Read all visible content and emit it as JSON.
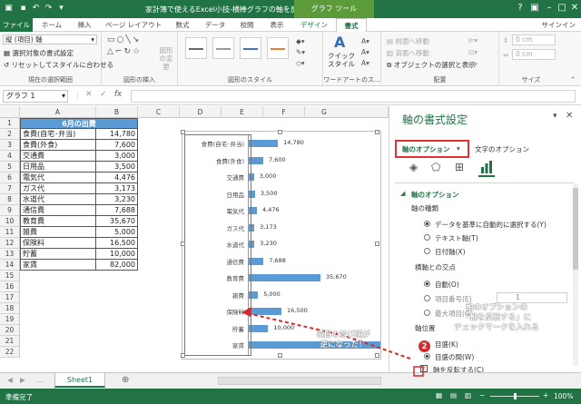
{
  "window": {
    "title": "家計簿で使えるExcel小技-横棒グラフの軸を反転させる - Excel",
    "context_tab": "グラフ ツール",
    "user": "サインイン"
  },
  "tabs": [
    "ファイル",
    "ホーム",
    "挿入",
    "ページ レイアウト",
    "数式",
    "データ",
    "校閲",
    "表示",
    "デザイン",
    "書式"
  ],
  "ribbon": {
    "selection_dropdown": "縦 (項目) 軸",
    "format_selection": "選択対象の書式設定",
    "reset_style": "リセットしてスタイルに合わせる",
    "group_current": "現在の選択範囲",
    "group_insert_shapes": "図形の挿入",
    "change_shape": "図形の変更",
    "group_shape_styles": "図形のスタイル",
    "quick_style": "クイック スタイル",
    "group_wordart": "ワードアートのス...",
    "bring_forward": "前面へ移動",
    "send_backward": "背面へ移動",
    "selection_pane": "オブジェクトの選択と表示",
    "group_arrange": "配置",
    "height_value": "0 cm",
    "width_value": "0 cm",
    "group_size": "サイズ"
  },
  "formula_bar": {
    "name_box": "グラフ 1",
    "fx": "fx"
  },
  "columns": [
    "A",
    "B",
    "C",
    "D",
    "E",
    "F",
    "G"
  ],
  "rows": [
    "1",
    "2",
    "3",
    "4",
    "5",
    "6",
    "7",
    "8",
    "9",
    "10",
    "11",
    "12",
    "13",
    "14",
    "15",
    "16",
    "17",
    "18",
    "19",
    "20",
    "21",
    "22"
  ],
  "table": {
    "header": "6月の出費",
    "items": [
      {
        "name": "食費(自宅･弁当)",
        "value": "14,780"
      },
      {
        "name": "食費(外食)",
        "value": "7,600"
      },
      {
        "name": "交通費",
        "value": "3,000"
      },
      {
        "name": "日用品",
        "value": "3,500"
      },
      {
        "name": "電気代",
        "value": "4,476"
      },
      {
        "name": "ガス代",
        "value": "3,173"
      },
      {
        "name": "水道代",
        "value": "3,230"
      },
      {
        "name": "通信費",
        "value": "7,688"
      },
      {
        "name": "教育費",
        "value": "35,670"
      },
      {
        "name": "雑費",
        "value": "5,000"
      },
      {
        "name": "保険料",
        "value": "16,500"
      },
      {
        "name": "貯蓄",
        "value": "10,000"
      },
      {
        "name": "家賃",
        "value": "82,000"
      }
    ]
  },
  "chart_data": {
    "type": "bar",
    "orientation": "horizontal",
    "categories": [
      "食費(自宅･弁当)",
      "食費(外食)",
      "交通費",
      "日用品",
      "電気代",
      "ガス代",
      "水道代",
      "通信費",
      "教育費",
      "雑費",
      "保険料",
      "貯蓄",
      "家賃"
    ],
    "values": [
      14780,
      7600,
      3000,
      3500,
      4476,
      3173,
      3230,
      7688,
      35670,
      5000,
      16500,
      10000,
      82000
    ],
    "data_labels": [
      "14,780",
      "7,600",
      "3,000",
      "3,500",
      "4,476",
      "3,173",
      "3,230",
      "7,688",
      "35,670",
      "5,000",
      "16,500",
      "10,000",
      ""
    ],
    "color": "#5b9bd5",
    "axis_reversed": true,
    "xlim": [
      0,
      82000
    ]
  },
  "pane": {
    "title": "軸の書式設定",
    "tab_axis_options": "軸のオプション",
    "tab_text_options": "文字のオプション",
    "section": "軸のオプション",
    "axis_type_label": "軸の種類",
    "axis_type_options": [
      "データを基準に自動的に選択する(Y)",
      "テキスト軸(T)",
      "日付軸(X)"
    ],
    "cross_label": "横軸との交点",
    "cross_options": [
      "自動(O)",
      "項目番号(E)",
      "最大項目(G)"
    ],
    "cross_number": "1",
    "position_label": "軸位置",
    "position_options": [
      "目盛(K)",
      "目盛の間(W)"
    ],
    "reverse_label": "軸を反転する(C)"
  },
  "annotations": {
    "callout_left": "項目の並び順が\n逆になった！",
    "callout_right": "軸のオプションの\n「軸を反転する」に\nチェックマークを入れる",
    "badge": "2",
    "accent": "#d32b2b"
  },
  "sheet_tab": "Sheet1",
  "status": {
    "ready": "準備完了",
    "zoom": "100%"
  }
}
